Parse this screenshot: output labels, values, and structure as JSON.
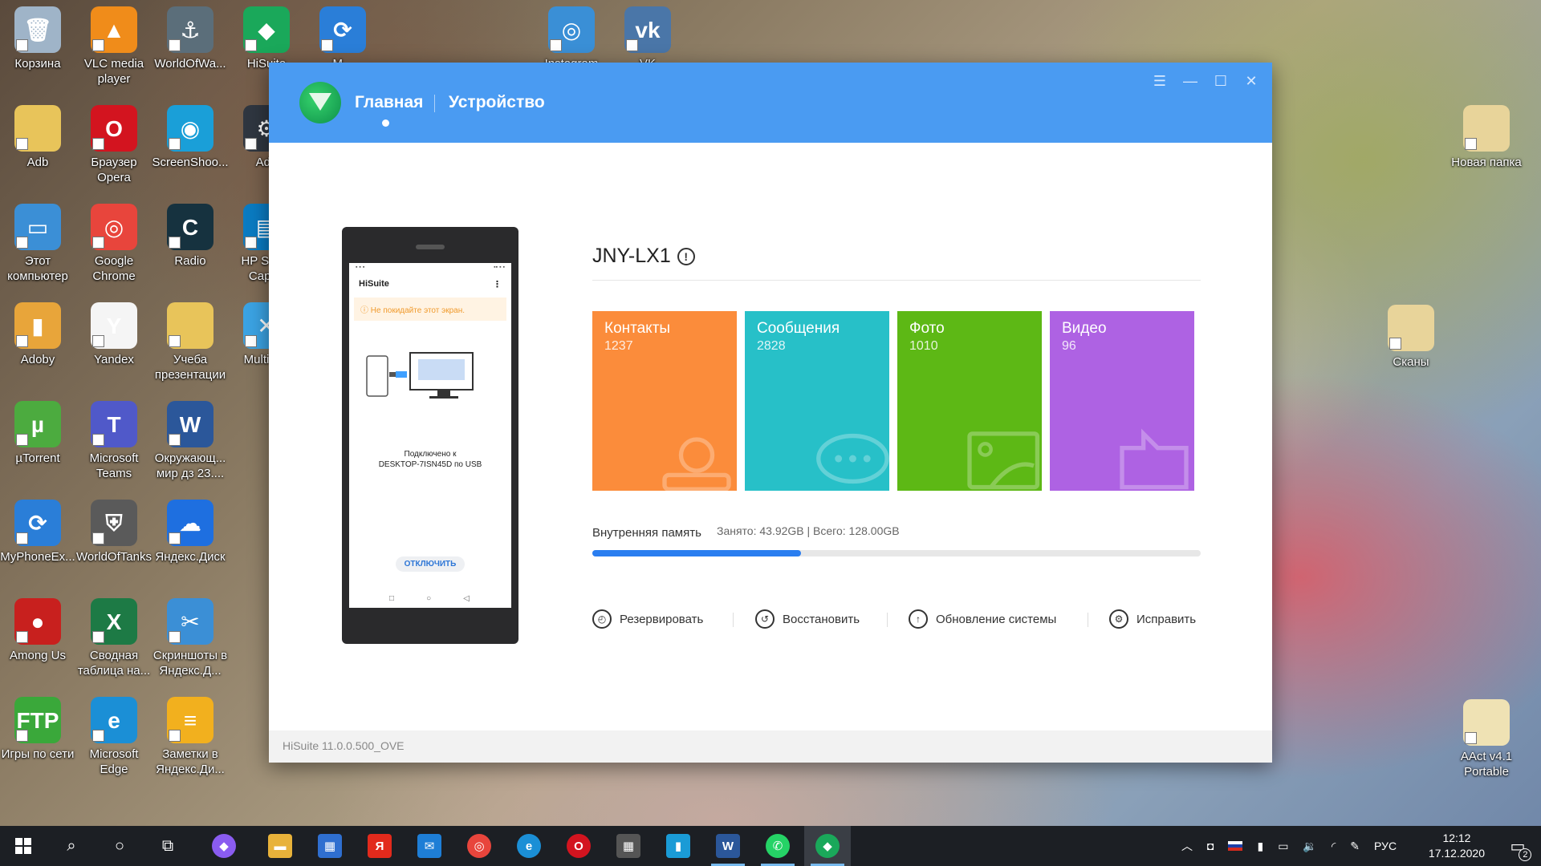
{
  "desktop": {
    "icons_left": [
      {
        "label": "Корзина",
        "color": "#9fb4c8",
        "glyph": "🗑"
      },
      {
        "label": "VLC media player",
        "color": "#f08c1a",
        "glyph": "▲"
      },
      {
        "label": "WorldOfWa...",
        "color": "#5b6e7a",
        "glyph": "⚓"
      },
      {
        "label": "HiSuite",
        "color": "#1aa85a",
        "glyph": "◆"
      },
      {
        "label": "M...",
        "color": "#2a7ed8",
        "glyph": "⟳"
      },
      {
        "label": "Adb",
        "color": "#e8c45a",
        "glyph": ""
      },
      {
        "label": "Браузер Opera",
        "color": "#d3141f",
        "glyph": "O"
      },
      {
        "label": "ScreenShoo...",
        "color": "#1a9fd8",
        "glyph": "◉"
      },
      {
        "label": "Adb",
        "color": "#2f3640",
        "glyph": "⚙"
      },
      {
        "label": "Этот компьютер",
        "color": "#3b8fd6",
        "glyph": "▭"
      },
      {
        "label": "Google Chrome",
        "color": "#e8453c",
        "glyph": "◎"
      },
      {
        "label": "Radio",
        "color": "#16323f",
        "glyph": "C"
      },
      {
        "label": "HP Sca... Capt...",
        "color": "#0a7bc2",
        "glyph": "▤"
      },
      {
        "label": "Adoby",
        "color": "#e8a53a",
        "glyph": "▮"
      },
      {
        "label": "Yandex",
        "color": "#f5f5f5",
        "glyph": "Y"
      },
      {
        "label": "Учеба презентации",
        "color": "#e8c45a",
        "glyph": ""
      },
      {
        "label": "Multi-T...",
        "color": "#3ba3e3",
        "glyph": "✕"
      },
      {
        "label": "µTorrent",
        "color": "#4cab3f",
        "glyph": "µ"
      },
      {
        "label": "Microsoft Teams",
        "color": "#5059c9",
        "glyph": "T"
      },
      {
        "label": "Окружающ... мир дз 23....",
        "color": "#2b579a",
        "glyph": "W"
      },
      {
        "label": "MyPhoneEx...",
        "color": "#2a7ed8",
        "glyph": "⟳"
      },
      {
        "label": "WorldOfTanks",
        "color": "#5a5a5a",
        "glyph": "⛨"
      },
      {
        "label": "Яндекс.Диск",
        "color": "#1e6fe0",
        "glyph": "☁"
      },
      {
        "label": "Among Us",
        "color": "#c8201e",
        "glyph": "●"
      },
      {
        "label": "Сводная таблица на...",
        "color": "#1d7a45",
        "glyph": "X"
      },
      {
        "label": "Скриншоты в Яндекс.Д...",
        "color": "#3b8fd6",
        "glyph": "✂"
      },
      {
        "label": "Игры по сети",
        "color": "#3aa83a",
        "glyph": "FTP"
      },
      {
        "label": "Microsoft Edge",
        "color": "#1b8fd6",
        "glyph": "e"
      },
      {
        "label": "Заметки в Яндекс.Ди...",
        "color": "#f2b01e",
        "glyph": "≡"
      }
    ],
    "icons_top": [
      {
        "label": "Instagram",
        "color": "#3a8fd6",
        "glyph": "◎"
      },
      {
        "label": "VK",
        "color": "#4a76a8",
        "glyph": "vk"
      }
    ],
    "icons_right": [
      {
        "label": "Новая папка",
        "color": "#e8d49a",
        "glyph": ""
      },
      {
        "label": "Сканы",
        "color": "#e8d49a",
        "glyph": ""
      },
      {
        "label": "AAct v4.1 Portable",
        "color": "#efe2b4",
        "glyph": ""
      }
    ]
  },
  "app": {
    "nav": {
      "home": "Главная",
      "device": "Устройство"
    },
    "controls": {
      "menu": "☰",
      "minimize": "—",
      "maximize": "☐",
      "close": "✕"
    },
    "phone": {
      "app_title": "HiSuite",
      "warning": "Не покидайте этот экран.",
      "connected_line1": "Подключено к",
      "connected_line2": "DESKTOP-7ISN45D по USB",
      "disconnect": "ОТКЛЮЧИТЬ"
    },
    "model": "JNY-LX1",
    "tiles": [
      {
        "label": "Контакты",
        "count": "1237",
        "color": "#fb8c3b"
      },
      {
        "label": "Сообщения",
        "count": "2828",
        "color": "#27c0c8"
      },
      {
        "label": "Фото",
        "count": "1010",
        "color": "#5db815"
      },
      {
        "label": "Видео",
        "count": "96",
        "color": "#ae62e3"
      }
    ],
    "storage": {
      "label": "Внутренняя память",
      "detail": "Занято: 43.92GB | Всего: 128.00GB",
      "used_fraction": 0.343
    },
    "actions": [
      {
        "label": "Резервировать",
        "icon": "backup-icon",
        "glyph": "◴"
      },
      {
        "label": "Восстановить",
        "icon": "restore-icon",
        "glyph": "↺"
      },
      {
        "label": "Обновление системы",
        "icon": "update-icon",
        "glyph": "↑"
      },
      {
        "label": "Исправить",
        "icon": "repair-icon",
        "glyph": "⚙"
      }
    ],
    "footer": "HiSuite 11.0.0.500_OVE"
  },
  "taskbar": {
    "language": "РУС",
    "time": "12:12",
    "date": "17.12.2020",
    "notifications": "2"
  }
}
